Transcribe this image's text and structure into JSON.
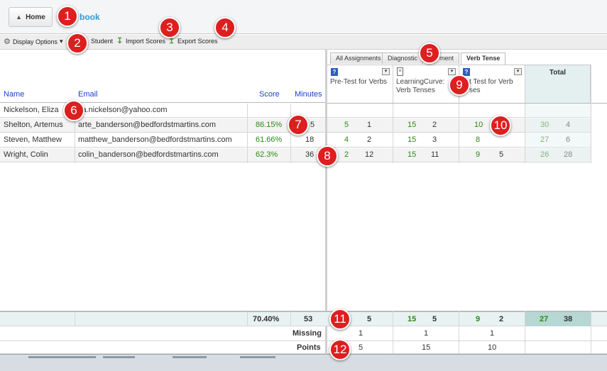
{
  "topbar": {
    "home_label": "Home",
    "app_title": "book"
  },
  "toolbar": {
    "display_options": "Display Options",
    "student": "Student",
    "import_scores": "Import Scores",
    "export_scores": "Export Scores"
  },
  "left_headers": {
    "name": "Name",
    "email": "Email",
    "score": "Score",
    "minutes": "Minutes"
  },
  "tabs": [
    "All Assignments",
    "Diagnostic",
    "ment",
    "Verb Tense"
  ],
  "assignments": [
    {
      "name_line1": "Pre-Test for Verbs",
      "name_line2": "",
      "icon": "quiz-icon"
    },
    {
      "name_line1": "LearningCurve:",
      "name_line2": "Verb Tenses",
      "icon": "document-icon"
    },
    {
      "name_line1": "t Test for Verb",
      "name_line2": "ses",
      "icon": "quiz-icon"
    }
  ],
  "total_label": "Total",
  "students": [
    {
      "name": "Nickelson, Eliza",
      "email": "za.nickelson@yahoo.com",
      "score": "",
      "minutes": "",
      "a1": [
        "",
        ""
      ],
      "a2": [
        "",
        ""
      ],
      "a3": [
        "",
        ""
      ],
      "total": [
        "",
        ""
      ]
    },
    {
      "name": "Shelton, Artemus",
      "email": "arte_banderson@bedfordstmartins.com",
      "score": "86.15%",
      "minutes": "5",
      "a1": [
        "5",
        "1"
      ],
      "a2": [
        "15",
        "2"
      ],
      "a3": [
        "10",
        ""
      ],
      "total": [
        "30",
        "4"
      ]
    },
    {
      "name": "Steven, Matthew",
      "email": "matthew_banderson@bedfordstmartins.com",
      "score": "61.66%",
      "minutes": "18",
      "a1": [
        "4",
        "2"
      ],
      "a2": [
        "15",
        "3"
      ],
      "a3": [
        "8",
        ""
      ],
      "total": [
        "27",
        "6"
      ]
    },
    {
      "name": "Wright, Colin",
      "email": "colin_banderson@bedfordstmartins.com",
      "score": "62.3%",
      "minutes": "36",
      "a1": [
        "2",
        "12"
      ],
      "a2": [
        "15",
        "11"
      ],
      "a3": [
        "9",
        "5"
      ],
      "total": [
        "26",
        "28"
      ]
    }
  ],
  "footer": {
    "avg_score": "70.40%",
    "avg_minutes": "53",
    "avg_a1": [
      "",
      "5"
    ],
    "avg_a2": [
      "15",
      "5"
    ],
    "avg_a3": [
      "9",
      "2"
    ],
    "avg_total": [
      "27",
      "38"
    ],
    "missing_label": "Missing",
    "missing": [
      "1",
      "1",
      "1"
    ],
    "points_label": "Points",
    "points": [
      "5",
      "15",
      "10"
    ]
  },
  "markers": [
    "1",
    "2",
    "3",
    "4",
    "5",
    "6",
    "7",
    "8",
    "9",
    "10",
    "11",
    "12"
  ],
  "colors": {
    "accent_link": "#1a3fd0",
    "score_green": "#2a8a17",
    "total_bg": "#e4f0f0",
    "marker_red": "#dd1f1f"
  }
}
